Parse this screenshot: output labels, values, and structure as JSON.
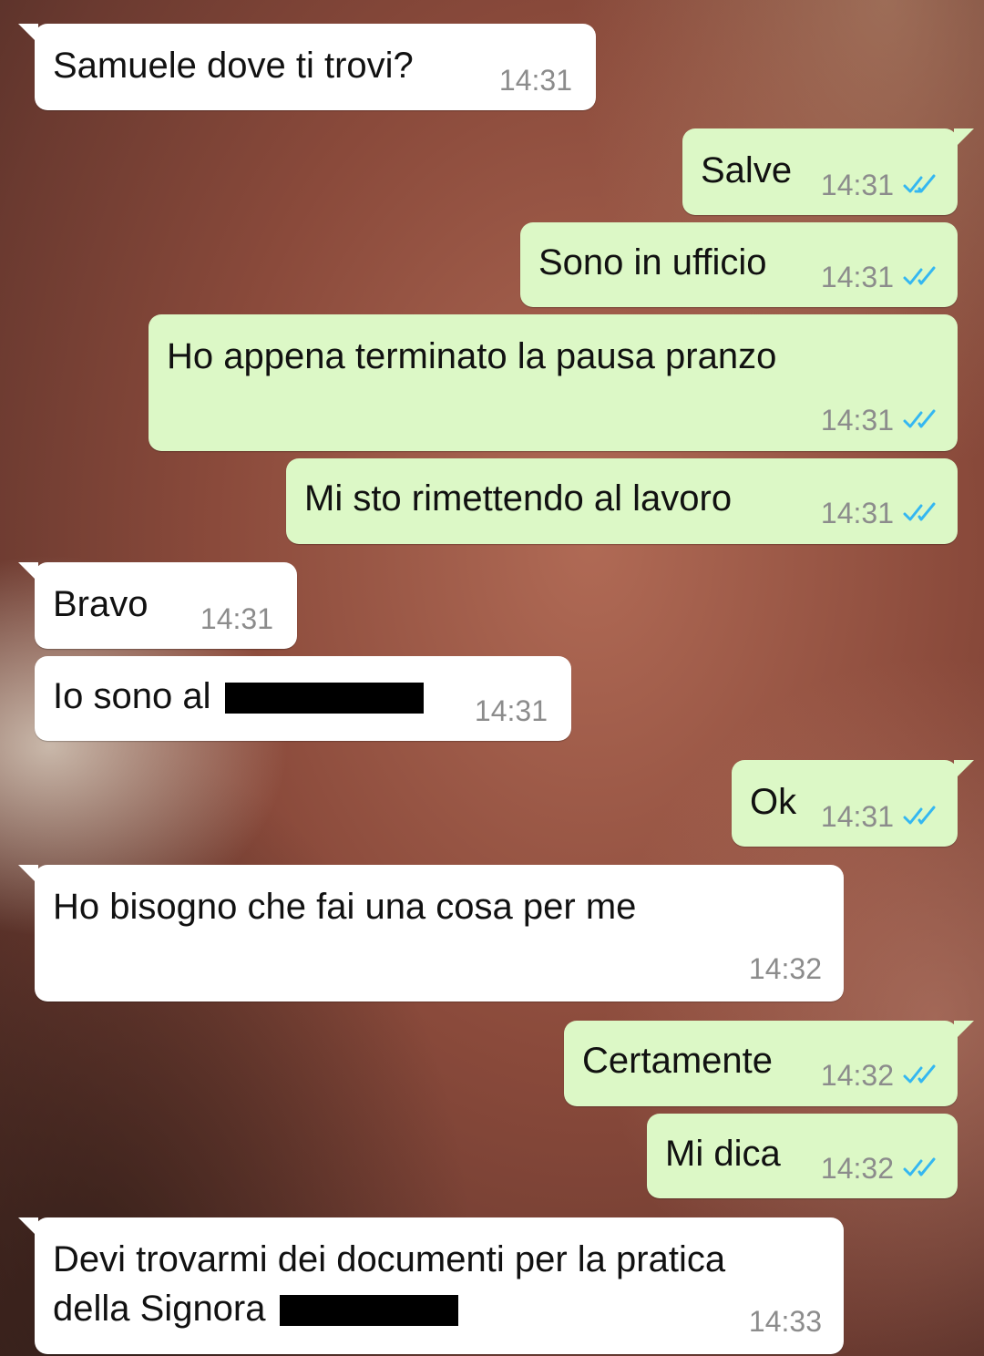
{
  "colors": {
    "incoming_bubble": "#ffffff",
    "outgoing_bubble": "#dcf8c6",
    "timestamp": "#8c8c8c",
    "read_tick": "#34b7f1"
  },
  "messages": [
    {
      "text": "Samuele dove ti trovi?",
      "time": "14:31",
      "direction": "in"
    },
    {
      "text": "Salve",
      "time": "14:31",
      "direction": "out",
      "status": "read"
    },
    {
      "text": "Sono in ufficio",
      "time": "14:31",
      "direction": "out",
      "status": "read"
    },
    {
      "text": "Ho appena terminato la pausa pranzo",
      "time": "14:31",
      "direction": "out",
      "status": "read"
    },
    {
      "text": "Mi sto rimettendo al lavoro",
      "time": "14:31",
      "direction": "out",
      "status": "read"
    },
    {
      "text": "Bravo",
      "time": "14:31",
      "direction": "in"
    },
    {
      "text": "Io sono al",
      "time": "14:31",
      "direction": "in"
    },
    {
      "text": "Ok",
      "time": "14:31",
      "direction": "out",
      "status": "read"
    },
    {
      "text": "Ho bisogno che fai una cosa per me",
      "time": "14:32",
      "direction": "in"
    },
    {
      "text": "Certamente",
      "time": "14:32",
      "direction": "out",
      "status": "read"
    },
    {
      "text": "Mi dica",
      "time": "14:32",
      "direction": "out",
      "status": "read"
    },
    {
      "text_line1": "Devi trovarmi dei documenti per la pratica",
      "text_line2": "della Signora",
      "time": "14:33",
      "direction": "in"
    }
  ]
}
